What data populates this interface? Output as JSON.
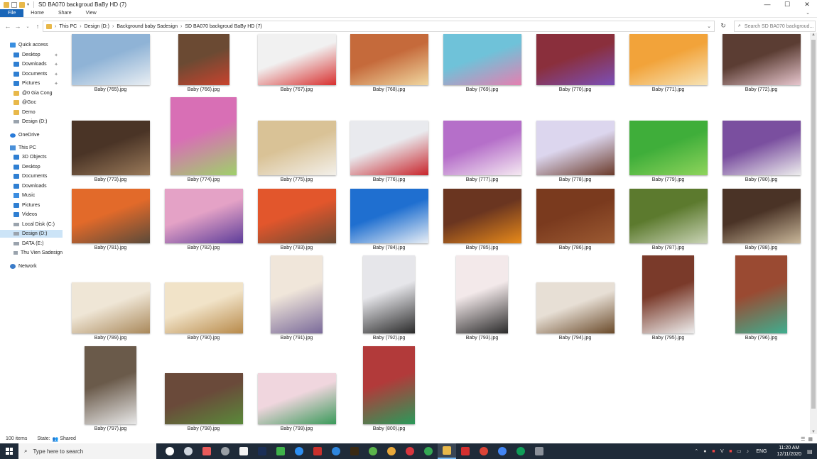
{
  "window": {
    "title": "SD BA070 backgroud BaBy HD (7)",
    "controls": {
      "minimize": "—",
      "maximize": "☐",
      "close": "✕"
    }
  },
  "ribbon": {
    "tabs": [
      "File",
      "Home",
      "Share",
      "View"
    ]
  },
  "address": {
    "crumbs": [
      "This PC",
      "Design (D:)",
      "Background baby Sadesign",
      "SD BA070 backgroud BaBy HD (7)"
    ],
    "search_placeholder": "Search SD BA070 backgroud..."
  },
  "nav": {
    "items": [
      {
        "label": "Quick access",
        "icon": "star-icon"
      },
      {
        "label": "Desktop",
        "icon": "desktop-icon",
        "pinned": true
      },
      {
        "label": "Downloads",
        "icon": "downloads-icon",
        "pinned": true
      },
      {
        "label": "Documents",
        "icon": "documents-icon",
        "pinned": true
      },
      {
        "label": "Pictures",
        "icon": "pictures-icon",
        "pinned": true
      },
      {
        "label": "@0 Gia Cong",
        "icon": "folder-icon"
      },
      {
        "label": "@Goc",
        "icon": "folder-icon"
      },
      {
        "label": "Demo",
        "icon": "folder-icon"
      },
      {
        "label": "Design (D:)",
        "icon": "drive-icon"
      },
      {
        "label": "OneDrive",
        "icon": "cloud-icon"
      },
      {
        "label": "This PC",
        "icon": "pc-icon"
      },
      {
        "label": "3D Objects",
        "icon": "cube-icon"
      },
      {
        "label": "Desktop",
        "icon": "desktop-icon"
      },
      {
        "label": "Documents",
        "icon": "documents-icon"
      },
      {
        "label": "Downloads",
        "icon": "downloads-icon"
      },
      {
        "label": "Music",
        "icon": "music-icon"
      },
      {
        "label": "Pictures",
        "icon": "pictures-icon"
      },
      {
        "label": "Videos",
        "icon": "videos-icon"
      },
      {
        "label": "Local Disk (C:)",
        "icon": "drive-icon"
      },
      {
        "label": "Design (D:)",
        "icon": "drive-icon",
        "selected": true
      },
      {
        "label": "DATA  (E:)",
        "icon": "drive-icon"
      },
      {
        "label": "Thu Vien Sadesign",
        "icon": "drive-icon"
      },
      {
        "label": "Network",
        "icon": "network-icon"
      }
    ]
  },
  "files": [
    {
      "name": "Baby (765).jpg",
      "colors": [
        "#8fb3d6",
        "#e9eef3"
      ]
    },
    {
      "name": "Baby (766).jpg",
      "colors": [
        "#6b4a33",
        "#c9432e"
      ]
    },
    {
      "name": "Baby (767).jpg",
      "colors": [
        "#f1f1f1",
        "#d8302f"
      ]
    },
    {
      "name": "Baby (768).jpg",
      "colors": [
        "#c56a3b",
        "#f0d7a0"
      ]
    },
    {
      "name": "Baby (769).jpg",
      "colors": [
        "#6fc2d9",
        "#e57fb0"
      ]
    },
    {
      "name": "Baby (770).jpg",
      "colors": [
        "#8a2f3c",
        "#7c4fb8"
      ]
    },
    {
      "name": "Baby (771).jpg",
      "colors": [
        "#f2a33a",
        "#f7e3b5"
      ]
    },
    {
      "name": "Baby (772).jpg",
      "colors": [
        "#5b3d33",
        "#e8c7cf"
      ]
    },
    {
      "name": "Baby (773).jpg",
      "colors": [
        "#4a3426",
        "#9a7a5a"
      ]
    },
    {
      "name": "Baby (774).jpg",
      "colors": [
        "#d86fb5",
        "#9fd06a"
      ]
    },
    {
      "name": "Baby (775).jpg",
      "colors": [
        "#d9c296",
        "#f3f0ea"
      ]
    },
    {
      "name": "Baby (776).jpg",
      "colors": [
        "#e9eaee",
        "#c8242b"
      ]
    },
    {
      "name": "Baby (777).jpg",
      "colors": [
        "#b56fc9",
        "#f5e9f2"
      ]
    },
    {
      "name": "Baby (778).jpg",
      "colors": [
        "#dcd6ee",
        "#6a3a2a"
      ]
    },
    {
      "name": "Baby (779).jpg",
      "colors": [
        "#3fae3a",
        "#8fd45c"
      ]
    },
    {
      "name": "Baby (780).jpg",
      "colors": [
        "#7a4f9f",
        "#eeeeee"
      ]
    },
    {
      "name": "Baby (781).jpg",
      "colors": [
        "#e26a2a",
        "#5a4a3a"
      ]
    },
    {
      "name": "Baby (782).jpg",
      "colors": [
        "#e4a2c6",
        "#5d3d9a"
      ]
    },
    {
      "name": "Baby (783).jpg",
      "colors": [
        "#e2562c",
        "#6b4a33"
      ]
    },
    {
      "name": "Baby (784).jpg",
      "colors": [
        "#1f6fd0",
        "#e8eef5"
      ]
    },
    {
      "name": "Baby (785).jpg",
      "colors": [
        "#6a3520",
        "#e88a1a"
      ]
    },
    {
      "name": "Baby (786).jpg",
      "colors": [
        "#7a3a1e",
        "#9c5a32"
      ]
    },
    {
      "name": "Baby (787).jpg",
      "colors": [
        "#5c7a2e",
        "#c9d3b5"
      ]
    },
    {
      "name": "Baby (788).jpg",
      "colors": [
        "#4a3326",
        "#c9b79a"
      ]
    },
    {
      "name": "Baby (789).jpg",
      "colors": [
        "#efe6d6",
        "#a9885a"
      ]
    },
    {
      "name": "Baby (790).jpg",
      "colors": [
        "#f1e3c8",
        "#b88a4a"
      ]
    },
    {
      "name": "Baby (791).jpg",
      "colors": [
        "#f0e6da",
        "#7a6a9a"
      ]
    },
    {
      "name": "Baby (792).jpg",
      "colors": [
        "#e6e6ea",
        "#2a2a2a"
      ]
    },
    {
      "name": "Baby (793).jpg",
      "colors": [
        "#f3e9ea",
        "#2a2a2a"
      ]
    },
    {
      "name": "Baby (794).jpg",
      "colors": [
        "#e7dfd5",
        "#6a4a2a"
      ]
    },
    {
      "name": "Baby (795).jpg",
      "colors": [
        "#7a3a2a",
        "#eeeeee"
      ]
    },
    {
      "name": "Baby (796).jpg",
      "colors": [
        "#9a4a32",
        "#3fae8f"
      ]
    },
    {
      "name": "Baby (797).jpg",
      "colors": [
        "#6a5a4a",
        "#e8e8e8"
      ]
    },
    {
      "name": "Baby (798).jpg",
      "colors": [
        "#6a4a3a",
        "#5a8a3a"
      ]
    },
    {
      "name": "Baby (799).jpg",
      "colors": [
        "#f0d6de",
        "#3a9a5a"
      ]
    },
    {
      "name": "Baby (800).jpg",
      "colors": [
        "#b23a3a",
        "#2a9a5a"
      ]
    }
  ],
  "status": {
    "count": "100 items",
    "state": "State:",
    "shared": "Shared"
  },
  "taskbar": {
    "search_placeholder": "Type here to search",
    "lang": "ENG",
    "time": "11:20 AM",
    "date": "12/11/2020"
  }
}
